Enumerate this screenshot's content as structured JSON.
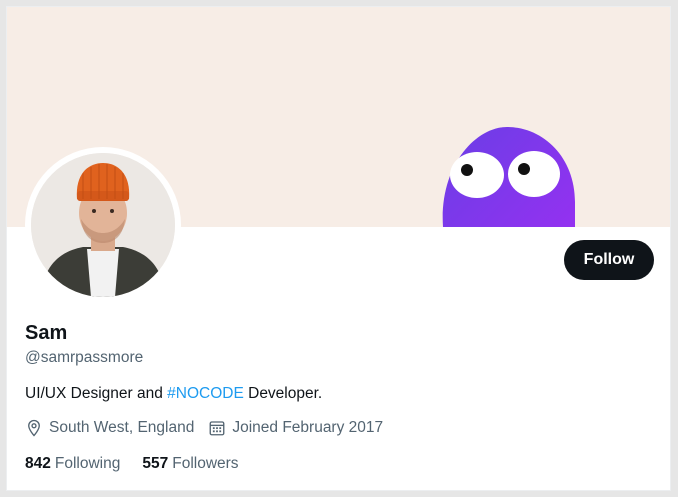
{
  "profile": {
    "name": "Sam",
    "handle": "@samrpassmore",
    "bio_prefix": "UI/UX Designer and ",
    "bio_hashtag": "#NOCODE",
    "bio_suffix": " Developer.",
    "location": "South West, England",
    "joined": "Joined February 2017",
    "following_count": "842",
    "following_label": "Following",
    "followers_count": "557",
    "followers_label": "Followers"
  },
  "actions": {
    "follow_label": "Follow"
  },
  "icons": {
    "location": "location-pin-icon",
    "joined": "calendar-icon"
  },
  "colors": {
    "banner": "#f7ede6",
    "button": "#0f1419",
    "hashtag": "#1d9bf0",
    "mascot": "#7b2fe0"
  }
}
